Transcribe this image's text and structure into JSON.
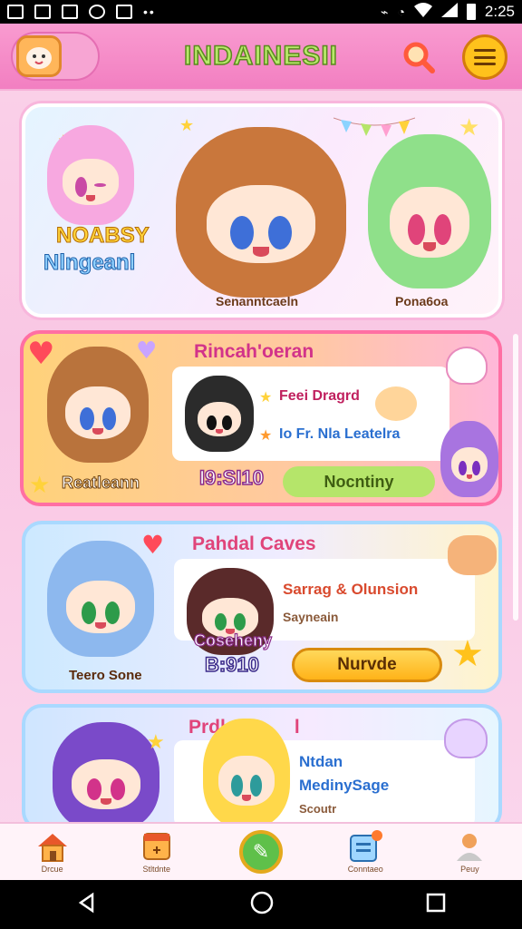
{
  "status_bar": {
    "time": "2:25",
    "more_glyph": "••"
  },
  "header": {
    "title": "INDAINESII",
    "avatar_icon": "chibi-avatar-icon",
    "search_icon": "search-icon",
    "menu_icon": "menu-icon"
  },
  "cards": [
    {
      "banner_line1": "NOABSY",
      "banner_line2": "Nlngeanl",
      "char_left_name": "Senanntcaeln",
      "char_right_name": "Pona6oa"
    },
    {
      "title": "Rincah'oeran",
      "char_name": "Reatleann",
      "feature1": "Feei Dragrd",
      "feature2": "Io Fr. Nla Leatelra",
      "price": "I9:SI10",
      "button_label": "Nocntiny"
    },
    {
      "title": "Pahdal Caves",
      "char_name_left": "Teero Sone",
      "char_name_mid": "Coseheny",
      "line1": "Sarrag & Olunsion",
      "line2": "Sayneain",
      "price": "B:910",
      "button_label": "Nurvde"
    },
    {
      "title": "Prdl",
      "title_end": "l",
      "line1": "Ntdan",
      "line2": "MedinySage",
      "line3": "Scoutr"
    }
  ],
  "bottom_nav": [
    {
      "label": "Drcue",
      "icon": "home-icon"
    },
    {
      "label": "Stltdnte",
      "icon": "calendar-icon"
    },
    {
      "label": "",
      "icon": "center-action-icon"
    },
    {
      "label": "Conntaeo",
      "icon": "clipboard-icon"
    },
    {
      "label": "Peuy",
      "icon": "profile-icon"
    }
  ],
  "colors": {
    "header_bg": "#f27fc1",
    "title_text": "#b8e86a",
    "accent_orange": "#ffb319",
    "accent_green": "#b5e56a",
    "card2_border": "#ff6fa3"
  }
}
